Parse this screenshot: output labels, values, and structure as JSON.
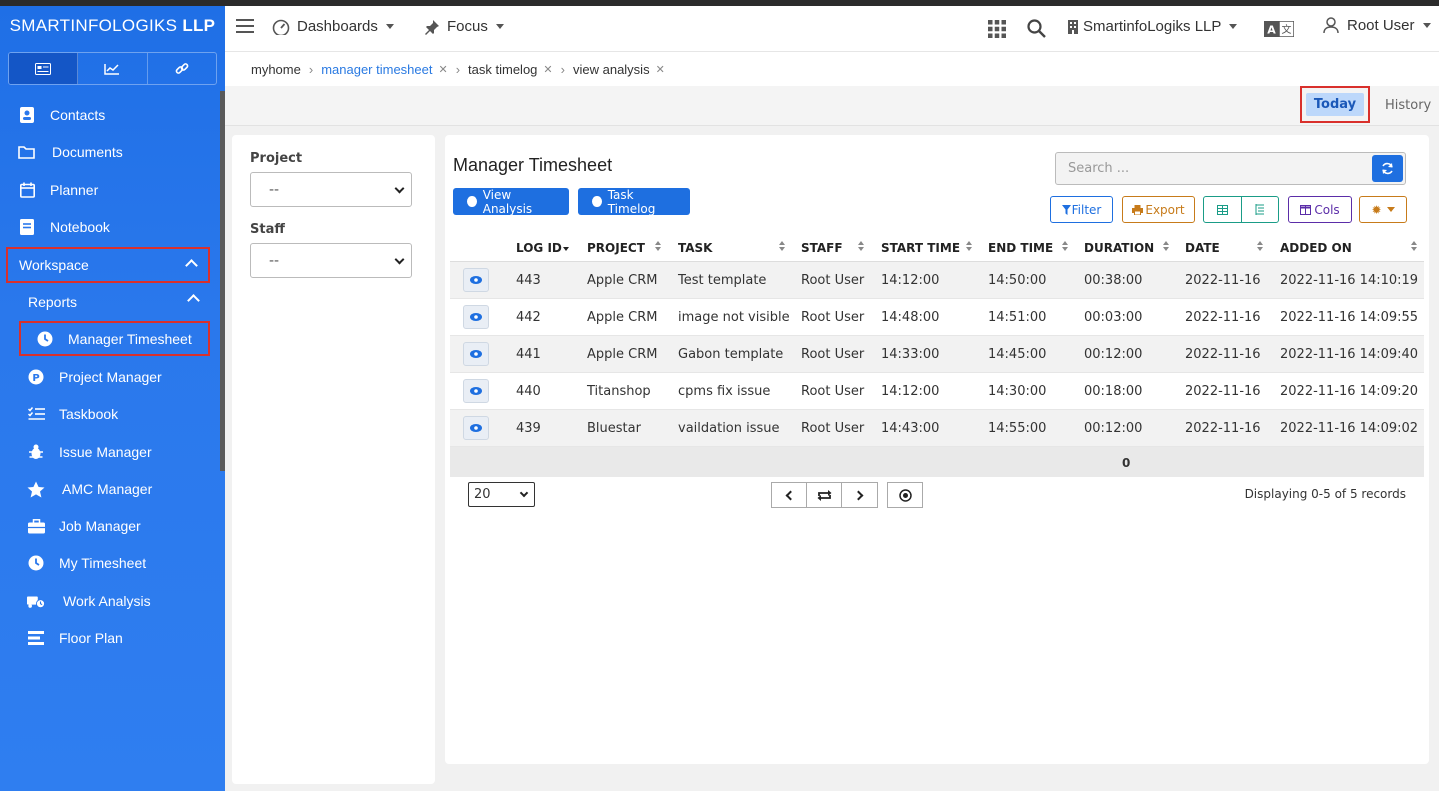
{
  "sidebar": {
    "brand_prefix": "SMARTINFOLOGIKS",
    "brand_suffix": "LLP",
    "mode_tabs": [
      "card-icon",
      "chart-icon",
      "link-icon"
    ],
    "items": [
      {
        "label": "Contacts",
        "icon": "contacts-icon"
      },
      {
        "label": "Documents",
        "icon": "folder-icon"
      },
      {
        "label": "Planner",
        "icon": "calendar-icon"
      },
      {
        "label": "Notebook",
        "icon": "notebook-icon"
      },
      {
        "label": "Workspace",
        "icon": ""
      },
      {
        "label": "Reports",
        "icon": ""
      },
      {
        "label": "Manager Timesheet",
        "icon": "clock-icon"
      },
      {
        "label": "Project Manager",
        "icon": "p-circle-icon"
      },
      {
        "label": "Taskbook",
        "icon": "checklist-icon"
      },
      {
        "label": "Issue Manager",
        "icon": "bug-icon"
      },
      {
        "label": "AMC Manager",
        "icon": "star-icon"
      },
      {
        "label": "Job Manager",
        "icon": "briefcase-icon"
      },
      {
        "label": "My Timesheet",
        "icon": "clock-icon"
      },
      {
        "label": "Work Analysis",
        "icon": "truck-clock-icon"
      },
      {
        "label": "Floor Plan",
        "icon": "bars-icon"
      }
    ]
  },
  "header": {
    "dashboards": "Dashboards",
    "focus": "Focus",
    "company": "SmartinfoLogiks LLP",
    "user": "Root User"
  },
  "breadcrumb": {
    "home": "myhome",
    "items": [
      "manager timesheet",
      "task timelog",
      "view analysis"
    ]
  },
  "tabs": {
    "today": "Today",
    "history": "History"
  },
  "filters": {
    "project_label": "Project",
    "project_value": "--",
    "staff_label": "Staff",
    "staff_value": "--"
  },
  "main": {
    "title": "Manager Timesheet",
    "view_analysis": "View Analysis",
    "task_timelog": "Task Timelog",
    "search_placeholder": "Search ...",
    "filter_btn": "Filter",
    "export_btn": "Export",
    "cols_btn": "Cols",
    "colors": {
      "primary": "#1e6fe0",
      "filter": "#1e6fe0",
      "export": "#c77b1a",
      "cols": "#5b2da8",
      "settings": "#c77b1a"
    }
  },
  "table": {
    "columns": [
      "LOG ID",
      "PROJECT",
      "TASK",
      "STAFF",
      "START TIME",
      "END TIME",
      "DURATION",
      "DATE",
      "ADDED ON"
    ],
    "rows": [
      [
        "443",
        "Apple CRM",
        "Test template",
        "Root User",
        "14:12:00",
        "14:50:00",
        "00:38:00",
        "2022-11-16",
        "2022-11-16 14:10:19"
      ],
      [
        "442",
        "Apple CRM",
        "image not visible",
        "Root User",
        "14:48:00",
        "14:51:00",
        "00:03:00",
        "2022-11-16",
        "2022-11-16 14:09:55"
      ],
      [
        "441",
        "Apple CRM",
        "Gabon template",
        "Root User",
        "14:33:00",
        "14:45:00",
        "00:12:00",
        "2022-11-16",
        "2022-11-16 14:09:40"
      ],
      [
        "440",
        "Titanshop",
        "cpms fix issue",
        "Root User",
        "14:12:00",
        "14:30:00",
        "00:18:00",
        "2022-11-16",
        "2022-11-16 14:09:20"
      ],
      [
        "439",
        "Bluestar",
        "vaildation issue",
        "Root User",
        "14:43:00",
        "14:55:00",
        "00:12:00",
        "2022-11-16",
        "2022-11-16 14:09:02"
      ]
    ],
    "footer_total": "0",
    "page_size": "20",
    "records": "Displaying 0-5 of 5 records"
  }
}
